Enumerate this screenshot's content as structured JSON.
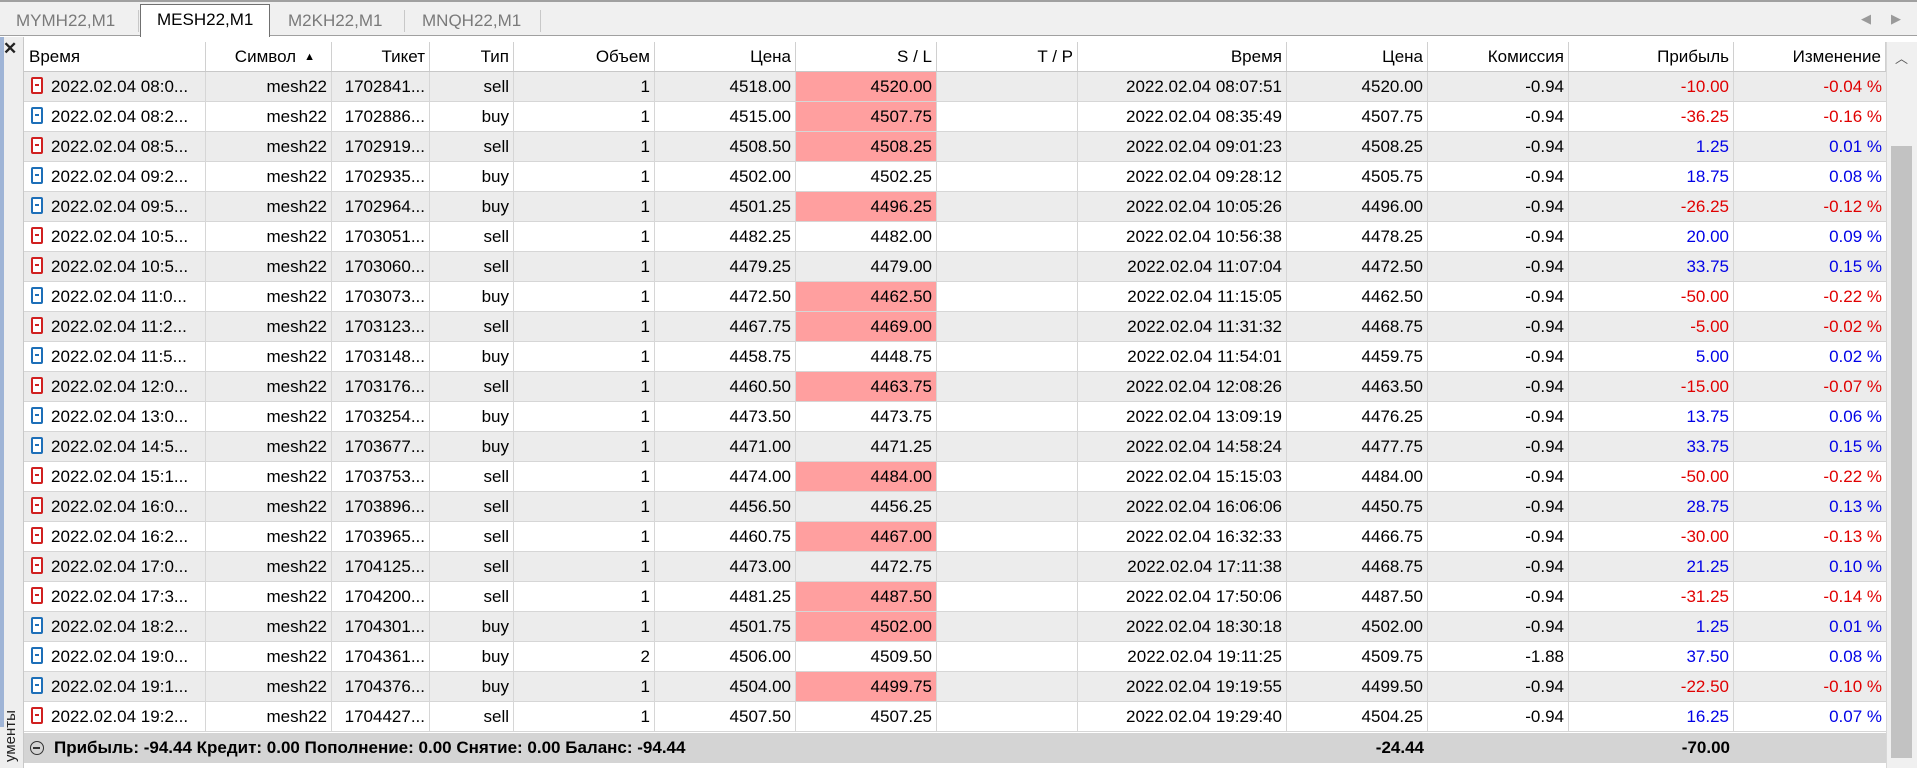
{
  "tabs": [
    {
      "label": "MYMH22,M1",
      "active": false
    },
    {
      "label": "MESH22,M1",
      "active": true
    },
    {
      "label": "M2KH22,M1",
      "active": false
    },
    {
      "label": "MNQH22,M1",
      "active": false
    }
  ],
  "sidebar": {
    "vertical_label": "ументы"
  },
  "columns": [
    "Время",
    "Символ",
    "Тикет",
    "Тип",
    "Объем",
    "Цена",
    "S / L",
    "T / P",
    "Время",
    "Цена",
    "Комиссия",
    "Прибыль",
    "Изменение"
  ],
  "sort_indicator": "▲",
  "colors": {
    "sl_hit": "#ff9f9f",
    "negative": "#e00000",
    "positive": "#0000e6",
    "alt_row": "#ececec",
    "summary_bg": "#d4d4d4"
  },
  "rows": [
    {
      "open_time": "2022.02.04 08:0...",
      "symbol": "mesh22",
      "ticket": "1702841...",
      "type": "sell",
      "volume": "1",
      "price": "4518.00",
      "sl": "4520.00",
      "sl_hit": true,
      "tp": "",
      "close_time": "2022.02.04 08:07:51",
      "close_price": "4520.00",
      "commission": "-0.94",
      "profit": "-10.00",
      "change": "-0.04 %"
    },
    {
      "open_time": "2022.02.04 08:2...",
      "symbol": "mesh22",
      "ticket": "1702886...",
      "type": "buy",
      "volume": "1",
      "price": "4515.00",
      "sl": "4507.75",
      "sl_hit": true,
      "tp": "",
      "close_time": "2022.02.04 08:35:49",
      "close_price": "4507.75",
      "commission": "-0.94",
      "profit": "-36.25",
      "change": "-0.16 %"
    },
    {
      "open_time": "2022.02.04 08:5...",
      "symbol": "mesh22",
      "ticket": "1702919...",
      "type": "sell",
      "volume": "1",
      "price": "4508.50",
      "sl": "4508.25",
      "sl_hit": true,
      "tp": "",
      "close_time": "2022.02.04 09:01:23",
      "close_price": "4508.25",
      "commission": "-0.94",
      "profit": "1.25",
      "change": "0.01 %"
    },
    {
      "open_time": "2022.02.04 09:2...",
      "symbol": "mesh22",
      "ticket": "1702935...",
      "type": "buy",
      "volume": "1",
      "price": "4502.00",
      "sl": "4502.25",
      "sl_hit": false,
      "tp": "",
      "close_time": "2022.02.04 09:28:12",
      "close_price": "4505.75",
      "commission": "-0.94",
      "profit": "18.75",
      "change": "0.08 %"
    },
    {
      "open_time": "2022.02.04 09:5...",
      "symbol": "mesh22",
      "ticket": "1702964...",
      "type": "buy",
      "volume": "1",
      "price": "4501.25",
      "sl": "4496.25",
      "sl_hit": true,
      "tp": "",
      "close_time": "2022.02.04 10:05:26",
      "close_price": "4496.00",
      "commission": "-0.94",
      "profit": "-26.25",
      "change": "-0.12 %"
    },
    {
      "open_time": "2022.02.04 10:5...",
      "symbol": "mesh22",
      "ticket": "1703051...",
      "type": "sell",
      "volume": "1",
      "price": "4482.25",
      "sl": "4482.00",
      "sl_hit": false,
      "tp": "",
      "close_time": "2022.02.04 10:56:38",
      "close_price": "4478.25",
      "commission": "-0.94",
      "profit": "20.00",
      "change": "0.09 %"
    },
    {
      "open_time": "2022.02.04 10:5...",
      "symbol": "mesh22",
      "ticket": "1703060...",
      "type": "sell",
      "volume": "1",
      "price": "4479.25",
      "sl": "4479.00",
      "sl_hit": false,
      "tp": "",
      "close_time": "2022.02.04 11:07:04",
      "close_price": "4472.50",
      "commission": "-0.94",
      "profit": "33.75",
      "change": "0.15 %"
    },
    {
      "open_time": "2022.02.04 11:0...",
      "symbol": "mesh22",
      "ticket": "1703073...",
      "type": "buy",
      "volume": "1",
      "price": "4472.50",
      "sl": "4462.50",
      "sl_hit": true,
      "tp": "",
      "close_time": "2022.02.04 11:15:05",
      "close_price": "4462.50",
      "commission": "-0.94",
      "profit": "-50.00",
      "change": "-0.22 %"
    },
    {
      "open_time": "2022.02.04 11:2...",
      "symbol": "mesh22",
      "ticket": "1703123...",
      "type": "sell",
      "volume": "1",
      "price": "4467.75",
      "sl": "4469.00",
      "sl_hit": true,
      "tp": "",
      "close_time": "2022.02.04 11:31:32",
      "close_price": "4468.75",
      "commission": "-0.94",
      "profit": "-5.00",
      "change": "-0.02 %"
    },
    {
      "open_time": "2022.02.04 11:5...",
      "symbol": "mesh22",
      "ticket": "1703148...",
      "type": "buy",
      "volume": "1",
      "price": "4458.75",
      "sl": "4448.75",
      "sl_hit": false,
      "tp": "",
      "close_time": "2022.02.04 11:54:01",
      "close_price": "4459.75",
      "commission": "-0.94",
      "profit": "5.00",
      "change": "0.02 %"
    },
    {
      "open_time": "2022.02.04 12:0...",
      "symbol": "mesh22",
      "ticket": "1703176...",
      "type": "sell",
      "volume": "1",
      "price": "4460.50",
      "sl": "4463.75",
      "sl_hit": true,
      "tp": "",
      "close_time": "2022.02.04 12:08:26",
      "close_price": "4463.50",
      "commission": "-0.94",
      "profit": "-15.00",
      "change": "-0.07 %"
    },
    {
      "open_time": "2022.02.04 13:0...",
      "symbol": "mesh22",
      "ticket": "1703254...",
      "type": "buy",
      "volume": "1",
      "price": "4473.50",
      "sl": "4473.75",
      "sl_hit": false,
      "tp": "",
      "close_time": "2022.02.04 13:09:19",
      "close_price": "4476.25",
      "commission": "-0.94",
      "profit": "13.75",
      "change": "0.06 %"
    },
    {
      "open_time": "2022.02.04 14:5...",
      "symbol": "mesh22",
      "ticket": "1703677...",
      "type": "buy",
      "volume": "1",
      "price": "4471.00",
      "sl": "4471.25",
      "sl_hit": false,
      "tp": "",
      "close_time": "2022.02.04 14:58:24",
      "close_price": "4477.75",
      "commission": "-0.94",
      "profit": "33.75",
      "change": "0.15 %"
    },
    {
      "open_time": "2022.02.04 15:1...",
      "symbol": "mesh22",
      "ticket": "1703753...",
      "type": "sell",
      "volume": "1",
      "price": "4474.00",
      "sl": "4484.00",
      "sl_hit": true,
      "tp": "",
      "close_time": "2022.02.04 15:15:03",
      "close_price": "4484.00",
      "commission": "-0.94",
      "profit": "-50.00",
      "change": "-0.22 %"
    },
    {
      "open_time": "2022.02.04 16:0...",
      "symbol": "mesh22",
      "ticket": "1703896...",
      "type": "sell",
      "volume": "1",
      "price": "4456.50",
      "sl": "4456.25",
      "sl_hit": false,
      "tp": "",
      "close_time": "2022.02.04 16:06:06",
      "close_price": "4450.75",
      "commission": "-0.94",
      "profit": "28.75",
      "change": "0.13 %"
    },
    {
      "open_time": "2022.02.04 16:2...",
      "symbol": "mesh22",
      "ticket": "1703965...",
      "type": "sell",
      "volume": "1",
      "price": "4460.75",
      "sl": "4467.00",
      "sl_hit": true,
      "tp": "",
      "close_time": "2022.02.04 16:32:33",
      "close_price": "4466.75",
      "commission": "-0.94",
      "profit": "-30.00",
      "change": "-0.13 %"
    },
    {
      "open_time": "2022.02.04 17:0...",
      "symbol": "mesh22",
      "ticket": "1704125...",
      "type": "sell",
      "volume": "1",
      "price": "4473.00",
      "sl": "4472.75",
      "sl_hit": false,
      "tp": "",
      "close_time": "2022.02.04 17:11:38",
      "close_price": "4468.75",
      "commission": "-0.94",
      "profit": "21.25",
      "change": "0.10 %"
    },
    {
      "open_time": "2022.02.04 17:3...",
      "symbol": "mesh22",
      "ticket": "1704200...",
      "type": "sell",
      "volume": "1",
      "price": "4481.25",
      "sl": "4487.50",
      "sl_hit": true,
      "tp": "",
      "close_time": "2022.02.04 17:50:06",
      "close_price": "4487.50",
      "commission": "-0.94",
      "profit": "-31.25",
      "change": "-0.14 %"
    },
    {
      "open_time": "2022.02.04 18:2...",
      "symbol": "mesh22",
      "ticket": "1704301...",
      "type": "buy",
      "volume": "1",
      "price": "4501.75",
      "sl": "4502.00",
      "sl_hit": true,
      "tp": "",
      "close_time": "2022.02.04 18:30:18",
      "close_price": "4502.00",
      "commission": "-0.94",
      "profit": "1.25",
      "change": "0.01 %"
    },
    {
      "open_time": "2022.02.04 19:0...",
      "symbol": "mesh22",
      "ticket": "1704361...",
      "type": "buy",
      "volume": "2",
      "price": "4506.00",
      "sl": "4509.50",
      "sl_hit": false,
      "tp": "",
      "close_time": "2022.02.04 19:11:25",
      "close_price": "4509.75",
      "commission": "-1.88",
      "profit": "37.50",
      "change": "0.08 %"
    },
    {
      "open_time": "2022.02.04 19:1...",
      "symbol": "mesh22",
      "ticket": "1704376...",
      "type": "buy",
      "volume": "1",
      "price": "4504.00",
      "sl": "4499.75",
      "sl_hit": true,
      "tp": "",
      "close_time": "2022.02.04 19:19:55",
      "close_price": "4499.50",
      "commission": "-0.94",
      "profit": "-22.50",
      "change": "-0.10 %"
    },
    {
      "open_time": "2022.02.04 19:2...",
      "symbol": "mesh22",
      "ticket": "1704427...",
      "type": "sell",
      "volume": "1",
      "price": "4507.50",
      "sl": "4507.25",
      "sl_hit": false,
      "tp": "",
      "close_time": "2022.02.04 19:29:40",
      "close_price": "4504.25",
      "commission": "-0.94",
      "profit": "16.25",
      "change": "0.07 %"
    }
  ],
  "summary": {
    "text": "Прибыль: -94.44  Кредит: 0.00  Пополнение: 0.00  Снятие: 0.00  Баланс: -94.44",
    "commission_total": "-24.44",
    "profit_total": "-70.00"
  }
}
